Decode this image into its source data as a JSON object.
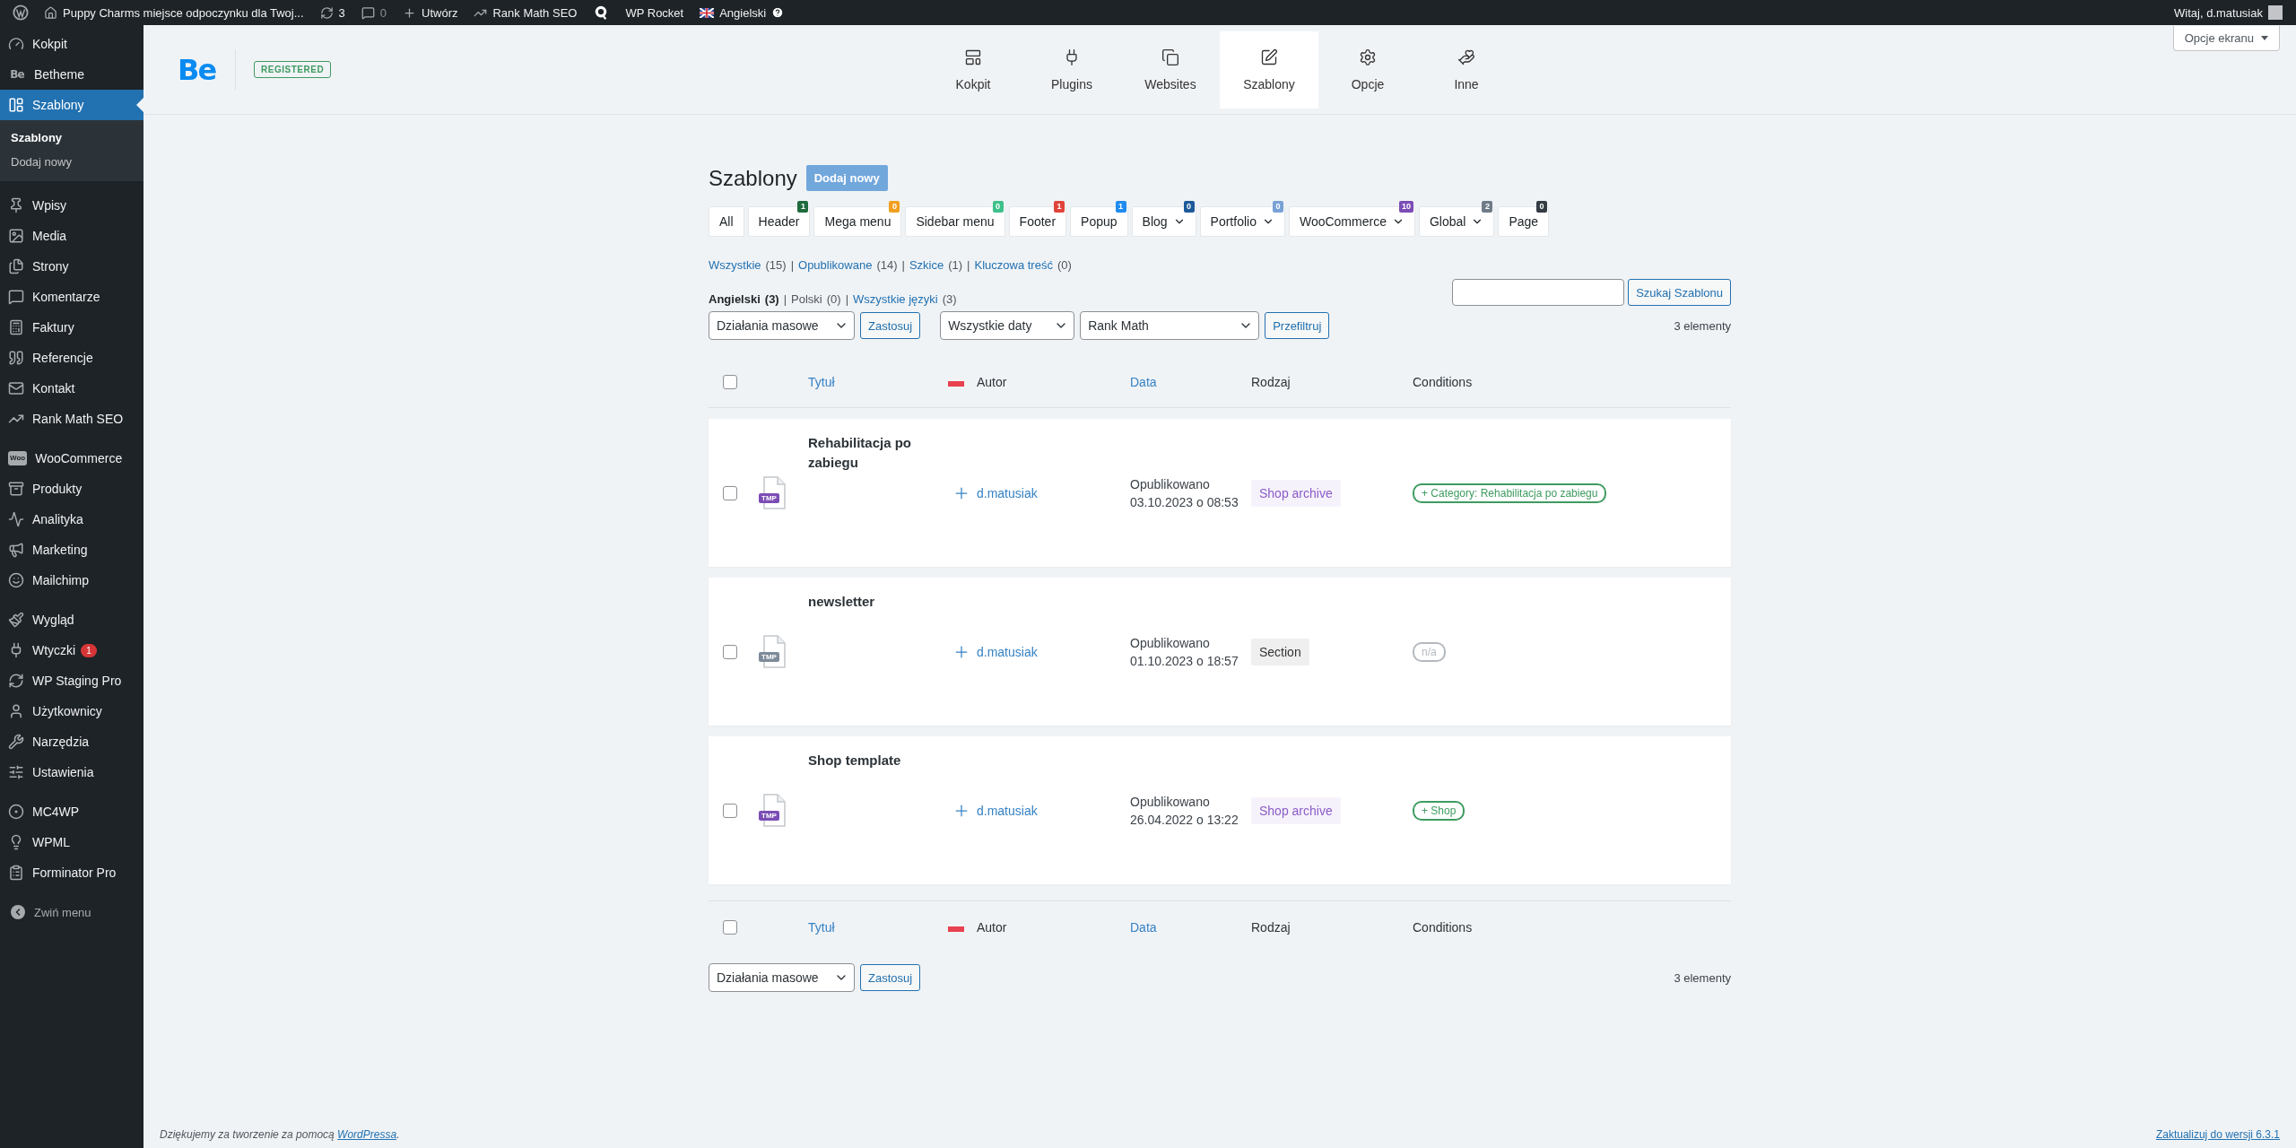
{
  "admin_bar": {
    "site_title": "Puppy Charms miejsce odpoczynku dla Twoj...",
    "updates": "3",
    "comments": "0",
    "new": "Utwórz",
    "seo": "Rank Math SEO",
    "rocket": "WP Rocket",
    "language": "Angielski",
    "greeting": "Witaj, d.matusiak"
  },
  "sidebar": {
    "groups": [
      {
        "items": [
          {
            "label": "Kokpit",
            "selected": false
          },
          {
            "label": "Betheme",
            "icon_text": "Be",
            "selected": false
          },
          {
            "label": "Szablony",
            "selected": true,
            "children": [
              {
                "label": "Szablony",
                "selected": true
              },
              {
                "label": "Dodaj nowy",
                "selected": false
              }
            ]
          }
        ]
      },
      {
        "items": [
          {
            "label": "Wpisy",
            "selected": false
          },
          {
            "label": "Media",
            "selected": false
          },
          {
            "label": "Strony",
            "selected": false
          },
          {
            "label": "Komentarze",
            "selected": false
          },
          {
            "label": "Faktury",
            "selected": false
          },
          {
            "label": "Referencje",
            "selected": false
          },
          {
            "label": "Kontakt",
            "selected": false
          },
          {
            "label": "Rank Math SEO",
            "selected": false
          }
        ]
      },
      {
        "items": [
          {
            "label": "WooCommerce",
            "icon_text": "Woo",
            "selected": false
          },
          {
            "label": "Produkty",
            "selected": false
          },
          {
            "label": "Analityka",
            "selected": false
          },
          {
            "label": "Marketing",
            "selected": false
          },
          {
            "label": "Mailchimp",
            "selected": false
          }
        ]
      },
      {
        "items": [
          {
            "label": "Wygląd",
            "selected": false
          },
          {
            "label": "Wtyczki",
            "badge": "1",
            "selected": false
          },
          {
            "label": "WP Staging Pro",
            "selected": false
          },
          {
            "label": "Użytkownicy",
            "selected": false
          },
          {
            "label": "Narzędzia",
            "selected": false
          },
          {
            "label": "Ustawienia",
            "selected": false
          }
        ]
      },
      {
        "items": [
          {
            "label": "MC4WP",
            "selected": false
          },
          {
            "label": "WPML",
            "selected": false
          },
          {
            "label": "Forminator Pro",
            "selected": false
          }
        ]
      }
    ],
    "collapse": "Zwiń menu"
  },
  "header": {
    "logo": "Be",
    "badge": "REGISTERED",
    "tabs": [
      {
        "label": "Kokpit",
        "selected": false
      },
      {
        "label": "Plugins",
        "selected": false
      },
      {
        "label": "Websites",
        "selected": false
      },
      {
        "label": "Szablony",
        "selected": true
      },
      {
        "label": "Opcje",
        "selected": false
      },
      {
        "label": "Inne",
        "selected": false
      }
    ],
    "screen_options": "Opcje ekranu"
  },
  "page": {
    "title": "Szablony",
    "add_new": "Dodaj nowy",
    "type_filters": [
      {
        "label": "All",
        "dropdown": false
      },
      {
        "label": "Header",
        "count": "1",
        "color": "#1e6b3c",
        "dropdown": false
      },
      {
        "label": "Mega menu",
        "count": "0",
        "color": "#f0a020",
        "dropdown": false
      },
      {
        "label": "Sidebar menu",
        "count": "0",
        "color": "#3ec08a",
        "dropdown": false
      },
      {
        "label": "Footer",
        "count": "1",
        "color": "#e0433a",
        "dropdown": false
      },
      {
        "label": "Popup",
        "count": "1",
        "color": "#1f8cf0",
        "dropdown": false
      },
      {
        "label": "Blog",
        "count": "0",
        "color": "#1d5a9a",
        "dropdown": true
      },
      {
        "label": "Portfolio",
        "count": "0",
        "color": "#7aa2d6",
        "dropdown": true
      },
      {
        "label": "WooCommerce",
        "count": "10",
        "color": "#7b4db5",
        "dropdown": true
      },
      {
        "label": "Global",
        "count": "2",
        "color": "#6f7b88",
        "dropdown": true
      },
      {
        "label": "Page",
        "count": "0",
        "color": "#333b44",
        "dropdown": false
      }
    ],
    "status_links": {
      "separator": "|",
      "items": [
        {
          "label": "Wszystkie",
          "count": "(15)"
        },
        {
          "label": "Opublikowane",
          "count": "(14)"
        },
        {
          "label": "Szkice",
          "count": "(1)"
        },
        {
          "label": "Kluczowa treść",
          "count": "(0)"
        }
      ]
    },
    "language_links": {
      "separator": "|",
      "items": [
        {
          "label": "Angielski",
          "count": "(3)",
          "selected": true,
          "link": false
        },
        {
          "label": "Polski",
          "count": "(0)",
          "selected": false,
          "link": false
        },
        {
          "label": "Wszystkie języki",
          "count": "(3)",
          "selected": false,
          "link": true
        }
      ]
    },
    "search": {
      "button": "Szukaj Szablonu"
    },
    "bulk_actions": "Działania masowe",
    "apply": "Zastosuj",
    "date_filter": "Wszystkie daty",
    "seo_filter": "Rank Math",
    "filter_button": "Przefiltruj",
    "item_count": "3 elementy"
  },
  "table": {
    "select_all": false,
    "footer_select_all": false,
    "footer_columns": [
      {
        "kind": "text",
        "label": "Tytuł",
        "link": true
      },
      {
        "kind": "flag"
      },
      {
        "kind": "text",
        "label": "Autor",
        "link": false
      },
      {
        "kind": "text",
        "label": "Data",
        "link": true
      },
      {
        "kind": "text",
        "label": "Rodzaj",
        "link": false
      },
      {
        "kind": "text",
        "label": "Conditions",
        "link": false
      }
    ],
    "columns": [
      {
        "kind": "text",
        "label": "Tytuł",
        "link": true
      },
      {
        "kind": "flag"
      },
      {
        "kind": "text",
        "label": "Autor",
        "link": false
      },
      {
        "kind": "text",
        "label": "Data",
        "link": true
      },
      {
        "kind": "text",
        "label": "Rodzaj",
        "link": false
      },
      {
        "kind": "text",
        "label": "Conditions",
        "link": false
      }
    ],
    "rows": [
      {
        "checked": false,
        "file_badge": "TMP",
        "color": "#7b4db5",
        "title": "Rehabilitacja po zabiegu",
        "author": "d.matusiak",
        "status": "Opublikowano",
        "date": "03.10.2023 o 08:53",
        "type": {
          "label": "Shop archive",
          "color": "#8a5cc7"
        },
        "condition": {
          "kind": "include",
          "label": "+ Category: Rehabilitacja po zabiegu"
        }
      },
      {
        "checked": false,
        "file_badge": "TMP",
        "color": "#7d8a99",
        "title": "newsletter",
        "author": "d.matusiak",
        "status": "Opublikowano",
        "date": "01.10.2023 o 18:57",
        "type": {
          "label": "Section",
          "color": "#333333"
        },
        "condition": {
          "kind": "none",
          "label": "n/a"
        }
      },
      {
        "checked": false,
        "file_badge": "TMP",
        "color": "#7b4db5",
        "title": "Shop template",
        "author": "d.matusiak",
        "status": "Opublikowano",
        "date": "26.04.2022 o 13:22",
        "type": {
          "label": "Shop archive",
          "color": "#8a5cc7"
        },
        "condition": {
          "kind": "include",
          "label": "+ Shop"
        }
      }
    ]
  },
  "bottom": {
    "bulk_actions": "Działania masowe",
    "apply": "Zastosuj",
    "item_count": "3 elementy"
  },
  "footer": {
    "thanks_before": "Dziękujemy za tworzenie za pomocą ",
    "thanks_link": "WordPressa",
    "thanks_after": ".",
    "version": "Zaktualizuj do wersji 6.3.1"
  }
}
